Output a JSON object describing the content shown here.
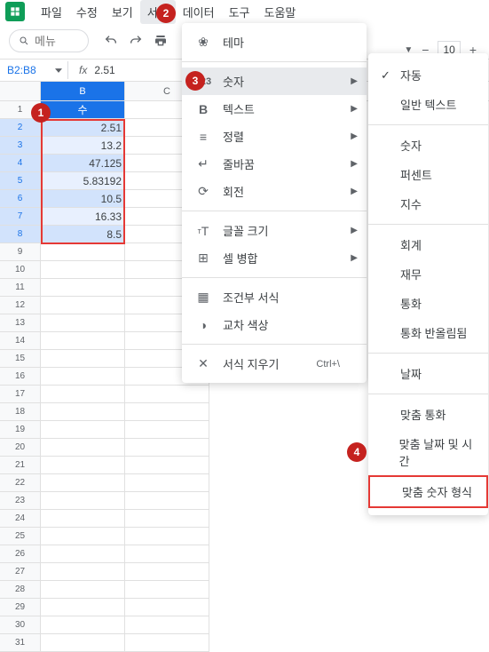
{
  "menubar": [
    "파일",
    "수정",
    "보기",
    "서식",
    "데이터",
    "도구",
    "도움말"
  ],
  "active_menu_index": 3,
  "search_placeholder": "메뉴",
  "zoom": "10",
  "namebox": "B2:B8",
  "formula_value": "2.51",
  "columns": [
    "B",
    "C"
  ],
  "row_numbers": [
    1,
    2,
    3,
    4,
    5,
    6,
    7,
    8,
    9,
    10,
    11,
    12,
    13,
    14,
    15,
    16,
    17,
    18,
    19,
    20,
    21,
    22,
    23,
    24,
    25,
    26,
    27,
    28,
    29,
    30,
    31
  ],
  "col_b_header": "수",
  "col_b_values": [
    "2.51",
    "13.2",
    "47.125",
    "5.83192",
    "10.5",
    "16.33",
    "8.5"
  ],
  "format_menu": {
    "theme": "테마",
    "number": "숫자",
    "text": "텍스트",
    "align": "정렬",
    "wrap": "줄바꿈",
    "rotate": "회전",
    "fontsize": "글꼴 크기",
    "merge": "셀 병합",
    "conditional": "조건부 서식",
    "altcolor": "교차 색상",
    "clear": "서식 지우기",
    "clear_shortcut": "Ctrl+\\"
  },
  "number_menu": {
    "auto": "자동",
    "plain": "일반 텍스트",
    "number": "숫자",
    "percent": "퍼센트",
    "sci": "지수",
    "accounting": "회계",
    "financial": "재무",
    "currency": "통화",
    "currency_round": "통화 반올림됨",
    "date": "날짜",
    "custom_currency": "맞춤 통화",
    "custom_datetime": "맞춤 날짜 및 시간",
    "custom_number": "맞춤 숫자 형식"
  },
  "badges": {
    "b1": "1",
    "b2": "2",
    "b3": "3",
    "b4": "4"
  }
}
